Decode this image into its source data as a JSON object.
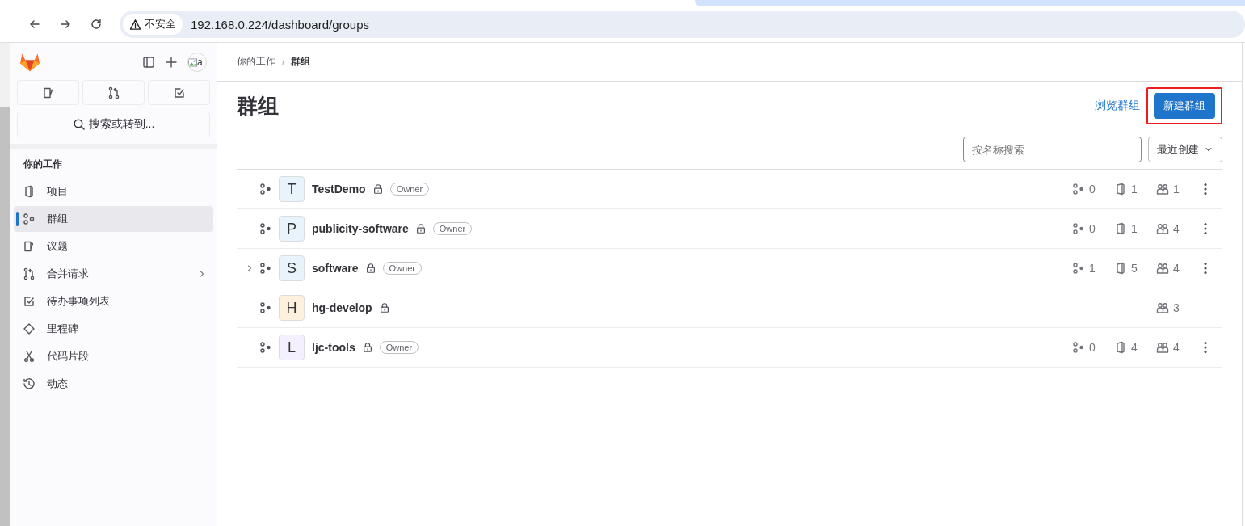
{
  "browser": {
    "security": "不安全",
    "url": "192.168.0.224/dashboard/groups"
  },
  "sidebar": {
    "avatar_alt": "a",
    "search": "搜索或转到...",
    "section": "你的工作",
    "items": [
      {
        "label": "项目",
        "kind": "project",
        "selected": false,
        "has_children": false
      },
      {
        "label": "群组",
        "kind": "group",
        "selected": true,
        "has_children": false
      },
      {
        "label": "议题",
        "kind": "issue",
        "selected": false,
        "has_children": false
      },
      {
        "label": "合并请求",
        "kind": "merge",
        "selected": false,
        "has_children": true
      },
      {
        "label": "待办事项列表",
        "kind": "todo",
        "selected": false,
        "has_children": false
      },
      {
        "label": "里程碑",
        "kind": "milestone",
        "selected": false,
        "has_children": false
      },
      {
        "label": "代码片段",
        "kind": "snippet",
        "selected": false,
        "has_children": false
      },
      {
        "label": "动态",
        "kind": "activity",
        "selected": false,
        "has_children": false
      }
    ]
  },
  "breadcrumb": [
    "你的工作",
    "群组"
  ],
  "breadcrumb_separator": "/",
  "title": "群组",
  "explore_link": "浏览群组",
  "new_button": {
    "label": "新建群组",
    "highlighted": true
  },
  "search": {
    "placeholder": "按名称搜索"
  },
  "sort": {
    "value": "最近创建"
  },
  "groups": [
    {
      "letter": "T",
      "color": "#e9f3fc",
      "name": "TestDemo",
      "role": "Owner",
      "expandable": false,
      "subgroups": "0",
      "projects": "1",
      "members": "1",
      "has_menu": true
    },
    {
      "letter": "P",
      "color": "#e9f3fc",
      "name": "publicity-software",
      "role": "Owner",
      "expandable": false,
      "subgroups": "0",
      "projects": "1",
      "members": "4",
      "has_menu": true
    },
    {
      "letter": "S",
      "color": "#e9f3fc",
      "name": "software",
      "role": "Owner",
      "expandable": true,
      "subgroups": "1",
      "projects": "5",
      "members": "4",
      "has_menu": true
    },
    {
      "letter": "H",
      "color": "#fdf1dd",
      "name": "hg-develop",
      "expandable": false,
      "members": "3",
      "has_menu": false
    },
    {
      "letter": "L",
      "color": "#f4f0ff",
      "name": "ljc-tools",
      "role": "Owner",
      "expandable": false,
      "subgroups": "0",
      "projects": "4",
      "members": "4",
      "has_menu": true
    }
  ]
}
